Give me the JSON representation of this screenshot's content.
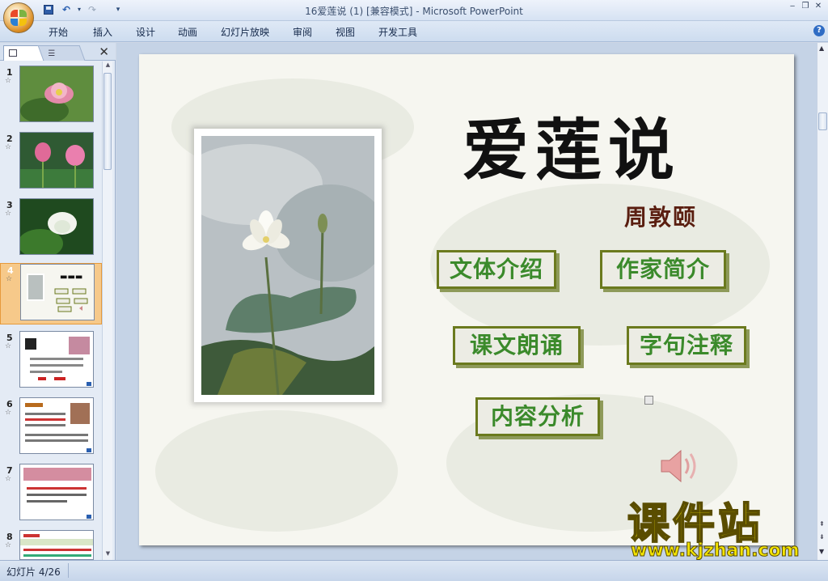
{
  "window": {
    "title": "16爱莲说 (1) [兼容模式] - Microsoft PowerPoint"
  },
  "ribbon": {
    "tabs": [
      "开始",
      "插入",
      "设计",
      "动画",
      "幻灯片放映",
      "审阅",
      "视图",
      "开发工具"
    ]
  },
  "slides_panel": {
    "thumbnails": [
      {
        "number": "1",
        "star": "☆"
      },
      {
        "number": "2",
        "star": "☆"
      },
      {
        "number": "3",
        "star": "☆"
      },
      {
        "number": "4",
        "star": "☆"
      },
      {
        "number": "5",
        "star": "☆"
      },
      {
        "number": "6",
        "star": "☆"
      },
      {
        "number": "7",
        "star": "☆"
      },
      {
        "number": "8",
        "star": "☆"
      }
    ],
    "active_index": 3
  },
  "slide": {
    "title": "爱莲说",
    "author": "周敦颐",
    "buttons": {
      "genre": "文体介绍",
      "author_intro": "作家简介",
      "reading": "课文朗诵",
      "notes": "字句注释",
      "analysis": "内容分析"
    }
  },
  "watermark": {
    "main": "课件站",
    "url": "www.kjzhan.com"
  },
  "statusbar": {
    "slide_info": "幻灯片 4/26"
  },
  "colors": {
    "button_text": "#3b8a2b",
    "button_border": "#6b7a1e",
    "watermark": "#f4e400"
  }
}
